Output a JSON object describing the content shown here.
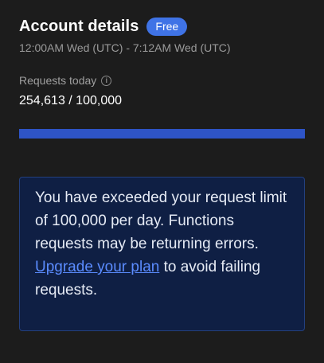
{
  "account": {
    "title": "Account details",
    "plan_badge": "Free",
    "time_range": "12:00AM Wed (UTC) - 7:12AM Wed (UTC)"
  },
  "requests": {
    "label": "Requests today",
    "info_icon": "info-icon",
    "value_text": "254,613 / 100,000",
    "used": 254613,
    "limit": 100000,
    "bar_fill_fraction": 1.0
  },
  "alert": {
    "message": "You have exceeded your request limit of 100,000 per day. Functions requests may be returning errors.",
    "link_text": "Upgrade your plan",
    "suffix": " to avoid failing requests."
  },
  "colors": {
    "background": "#1c1c1c",
    "badge": "#3f73e6",
    "progress": "#2e54c6",
    "alert_bg": "#0f1f44",
    "alert_border": "#23407f",
    "link": "#5b8cff"
  }
}
